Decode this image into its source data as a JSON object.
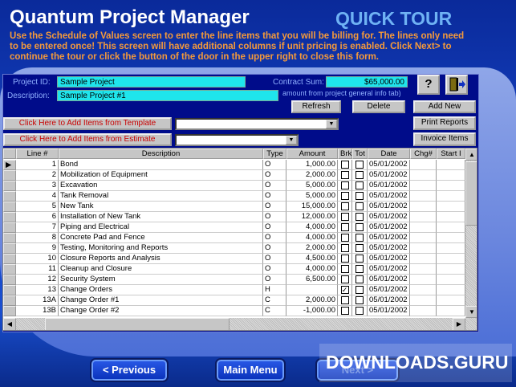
{
  "app_title": "Quantum Project Manager",
  "tour_label": "QUICK TOUR",
  "intro": "Use the Schedule of Values screen to enter the line items that you will be billing for. The lines only need to be entered once! This screen will have additional columns if unit pricing is enabled. Click Next> to continue the tour or click the button of the door in the upper right to close this form.",
  "form": {
    "project_id_label": "Project ID:",
    "project_id": "Sample Project",
    "description_label": "Description:",
    "description": "Sample Project #1",
    "contract_sum_label": "Contract Sum:",
    "contract_sum": "$65,000.00",
    "contract_note": "amount from project general info tab)",
    "help_label": "?",
    "refresh": "Refresh",
    "delete": "Delete",
    "add_new": "Add New",
    "print_reports": "Print Reports",
    "invoice_items": "Invoice Items",
    "add_template": "Click Here to Add Items from Template",
    "add_estimate": "Click Here to Add Items from Estimate"
  },
  "grid": {
    "columns": [
      "Line #",
      "Description",
      "Type",
      "Amount",
      "Brk",
      "Tot",
      "Date",
      "Chg#",
      "Start I"
    ],
    "rows": [
      {
        "line": "1",
        "desc": "Bond",
        "type": "O",
        "amount": "1,000.00",
        "brk": false,
        "tot": false,
        "date": "05/01/2002"
      },
      {
        "line": "2",
        "desc": "Mobilization of Equipment",
        "type": "O",
        "amount": "2,000.00",
        "brk": false,
        "tot": false,
        "date": "05/01/2002"
      },
      {
        "line": "3",
        "desc": "Excavation",
        "type": "O",
        "amount": "5,000.00",
        "brk": false,
        "tot": false,
        "date": "05/01/2002"
      },
      {
        "line": "4",
        "desc": "Tank Removal",
        "type": "O",
        "amount": "5,000.00",
        "brk": false,
        "tot": false,
        "date": "05/01/2002"
      },
      {
        "line": "5",
        "desc": "New Tank",
        "type": "O",
        "amount": "15,000.00",
        "brk": false,
        "tot": false,
        "date": "05/01/2002"
      },
      {
        "line": "6",
        "desc": "Installation of New Tank",
        "type": "O",
        "amount": "12,000.00",
        "brk": false,
        "tot": false,
        "date": "05/01/2002"
      },
      {
        "line": "7",
        "desc": "Piping and Electrical",
        "type": "O",
        "amount": "4,000.00",
        "brk": false,
        "tot": false,
        "date": "05/01/2002"
      },
      {
        "line": "8",
        "desc": "Concrete Pad and Fence",
        "type": "O",
        "amount": "4,000.00",
        "brk": false,
        "tot": false,
        "date": "05/01/2002"
      },
      {
        "line": "9",
        "desc": "Testing, Monitoring and Reports",
        "type": "O",
        "amount": "2,000.00",
        "brk": false,
        "tot": false,
        "date": "05/01/2002"
      },
      {
        "line": "10",
        "desc": "Closure Reports and Analysis",
        "type": "O",
        "amount": "4,500.00",
        "brk": false,
        "tot": false,
        "date": "05/01/2002"
      },
      {
        "line": "11",
        "desc": "Cleanup and Closure",
        "type": "O",
        "amount": "4,000.00",
        "brk": false,
        "tot": false,
        "date": "05/01/2002"
      },
      {
        "line": "12",
        "desc": "Security System",
        "type": "O",
        "amount": "6,500.00",
        "brk": false,
        "tot": false,
        "date": "05/01/2002"
      },
      {
        "line": "13",
        "desc": "Change Orders",
        "type": "H",
        "amount": "",
        "brk": true,
        "tot": false,
        "date": "05/01/2002"
      },
      {
        "line": "13A",
        "desc": "Change Order #1",
        "type": "C",
        "amount": "2,000.00",
        "brk": false,
        "tot": false,
        "date": "05/01/2002"
      },
      {
        "line": "13B",
        "desc": "Change Order #2",
        "type": "C",
        "amount": "-1,000.00",
        "brk": false,
        "tot": false,
        "date": "05/01/2002"
      }
    ]
  },
  "nav": {
    "previous": "< Previous",
    "main_menu": "Main Menu",
    "next": "Next >"
  },
  "watermark": "DOWNLOADS.GURU"
}
